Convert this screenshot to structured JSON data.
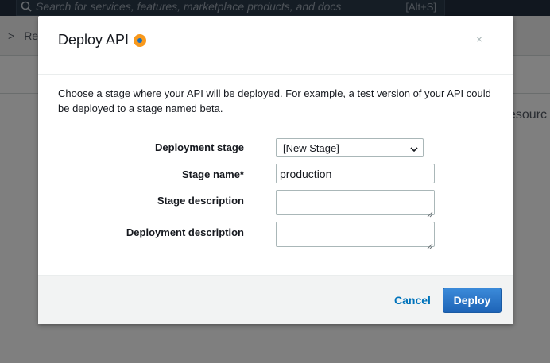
{
  "background": {
    "search_placeholder": "Search for services, features, marketplace products, and docs",
    "search_shortcut": "[Alt+S]",
    "breadcrumb_separator": ">",
    "breadcrumb_label": "Re",
    "partial_heading": "esourc"
  },
  "modal": {
    "title": "Deploy API",
    "close_label": "×",
    "intro_text": "Choose a stage where your API will be deployed. For example, a test version of your API could be deployed to a stage named beta.",
    "fields": {
      "deployment_stage": {
        "label": "Deployment stage",
        "value": "[New Stage]"
      },
      "stage_name": {
        "label": "Stage name*",
        "value": "production"
      },
      "stage_description": {
        "label": "Stage description",
        "value": ""
      },
      "deployment_description": {
        "label": "Deployment description",
        "value": ""
      }
    },
    "buttons": {
      "cancel": "Cancel",
      "deploy": "Deploy"
    }
  },
  "colors": {
    "accent": "#1e64b7",
    "link": "#0073bb",
    "info_icon": "#f8991d",
    "topbar": "#232f3e"
  },
  "icons": [
    "search-icon",
    "info-icon",
    "close-icon",
    "chevron-down-icon",
    "resize-grip-icon"
  ]
}
